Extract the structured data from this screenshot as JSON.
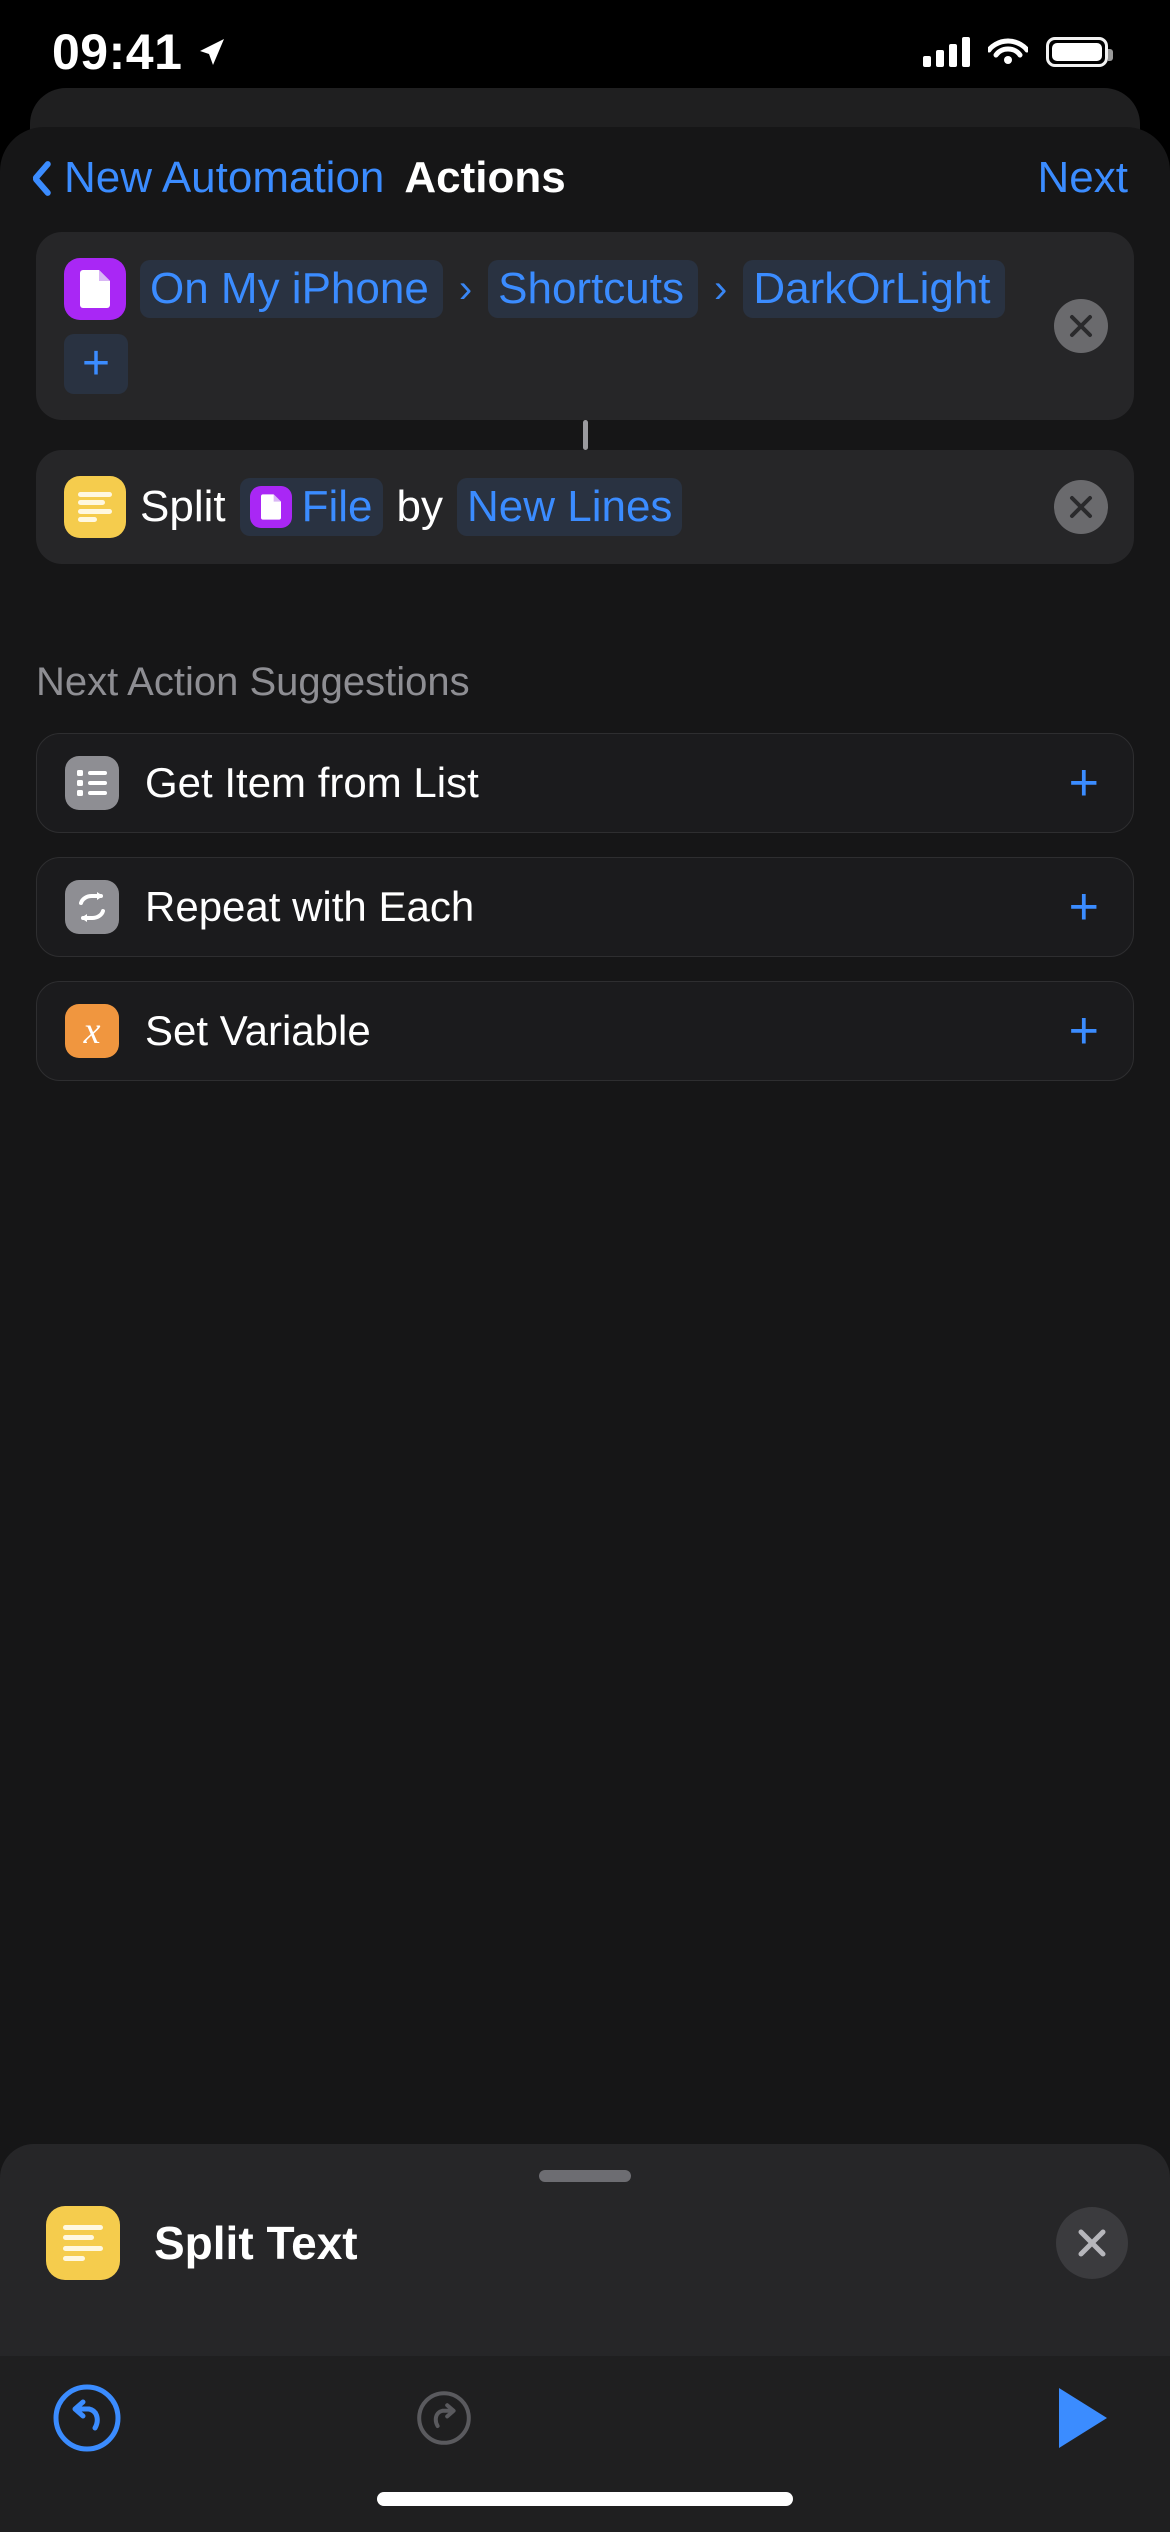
{
  "status_bar": {
    "time": "09:41",
    "location_icon": "location-arrow-icon",
    "signal_icon": "cellular-signal-icon",
    "wifi_icon": "wifi-icon",
    "battery_icon": "battery-full-icon"
  },
  "nav": {
    "back_icon": "chevron-left-icon",
    "back_label": "New Automation",
    "title": "Actions",
    "next_label": "Next"
  },
  "actions": [
    {
      "icon": "file-document-icon",
      "icon_color": "#a927f5",
      "tokens": [
        {
          "type": "path",
          "label": "On My iPhone"
        },
        {
          "type": "chevron",
          "label": "›"
        },
        {
          "type": "path",
          "label": "Shortcuts"
        },
        {
          "type": "chevron",
          "label": "›"
        },
        {
          "type": "path",
          "label": "DarkOrLight"
        },
        {
          "type": "plus",
          "label": "+"
        }
      ],
      "close_icon": "close-circle-icon"
    },
    {
      "icon": "text-lines-icon",
      "icon_color": "#f5cc4d",
      "verb": "Split",
      "variable": "File",
      "variable_icon": "file-document-icon",
      "variable_icon_color": "#a927f5",
      "preposition": "by",
      "separator": "New Lines",
      "close_icon": "close-circle-icon"
    }
  ],
  "suggestions": {
    "header": "Next Action Suggestions",
    "items": [
      {
        "icon": "list-bullets-icon",
        "icon_color": "#8e8e93",
        "label": "Get Item from List",
        "add_label": "+"
      },
      {
        "icon": "repeat-loop-icon",
        "icon_color": "#8e8e93",
        "label": "Repeat with Each",
        "add_label": "+"
      },
      {
        "icon": "variable-x-icon",
        "icon_color": "#f0963f",
        "label": "Set Variable",
        "add_label": "+",
        "glyph": "x"
      }
    ]
  },
  "bottom_sheet": {
    "grabber": "sheet-grabber",
    "icon": "text-lines-icon",
    "icon_color": "#f5cc4d",
    "title": "Split Text",
    "close_icon": "close-icon"
  },
  "toolbar": {
    "undo_icon": "undo-icon",
    "redo_icon": "redo-icon",
    "play_icon": "play-icon",
    "accent_color": "#3b8cff",
    "disabled_color": "#5a5a5e"
  }
}
